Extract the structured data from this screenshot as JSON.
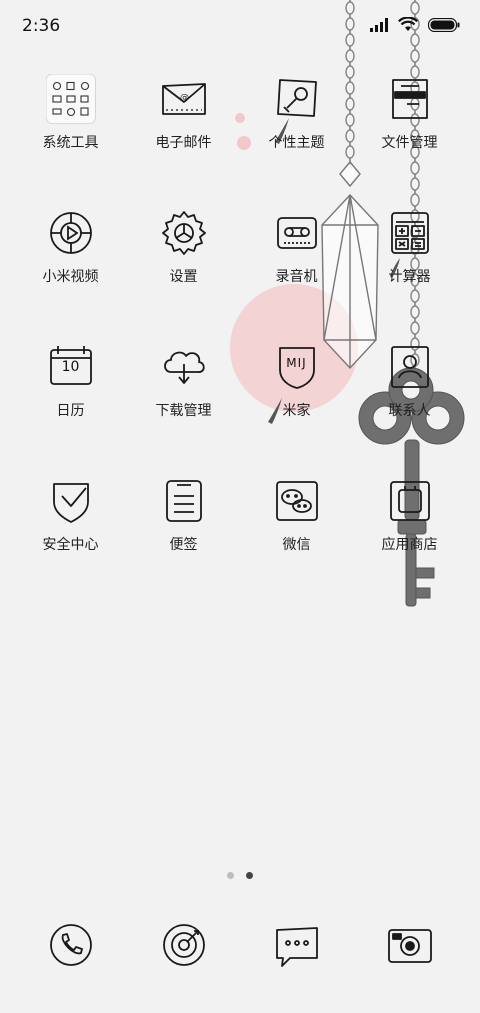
{
  "status_bar": {
    "time": "2:36"
  },
  "apps": [
    {
      "id": "tools",
      "label": "系统工具",
      "icon": "folder-grid-icon"
    },
    {
      "id": "email",
      "label": "电子邮件",
      "icon": "envelope-icon"
    },
    {
      "id": "themes",
      "label": "个性主题",
      "icon": "brush-icon"
    },
    {
      "id": "files",
      "label": "文件管理",
      "icon": "folder-icon"
    },
    {
      "id": "video",
      "label": "小米视频",
      "icon": "play-circle-icon"
    },
    {
      "id": "settings",
      "label": "设置",
      "icon": "gear-icon"
    },
    {
      "id": "recorder",
      "label": "录音机",
      "icon": "tape-recorder-icon"
    },
    {
      "id": "calculator",
      "label": "计算器",
      "icon": "calculator-icon"
    },
    {
      "id": "calendar",
      "label": "日历",
      "icon": "calendar-icon",
      "day": "10"
    },
    {
      "id": "downloads",
      "label": "下载管理",
      "icon": "cloud-download-icon"
    },
    {
      "id": "mijia",
      "label": "米家",
      "icon": "mi-shield-icon",
      "badge_text": "MIJ"
    },
    {
      "id": "contacts",
      "label": "联系人",
      "icon": "contact-card-icon"
    },
    {
      "id": "security",
      "label": "安全中心",
      "icon": "shield-check-icon"
    },
    {
      "id": "notes",
      "label": "便签",
      "icon": "notepad-icon"
    },
    {
      "id": "wechat",
      "label": "微信",
      "icon": "chat-bubbles-icon"
    },
    {
      "id": "appstore",
      "label": "应用商店",
      "icon": "store-icon"
    }
  ],
  "page_indicator": {
    "pages": 2,
    "current": 2
  },
  "dock": [
    {
      "id": "phone",
      "icon": "phone-icon"
    },
    {
      "id": "browser",
      "icon": "compass-icon"
    },
    {
      "id": "messages",
      "icon": "message-bubble-icon"
    },
    {
      "id": "camera",
      "icon": "camera-icon"
    }
  ],
  "colors": {
    "background": "#f2f2f3",
    "accent_pink": "#f3c8ca",
    "ink": "#1a1a1a"
  }
}
